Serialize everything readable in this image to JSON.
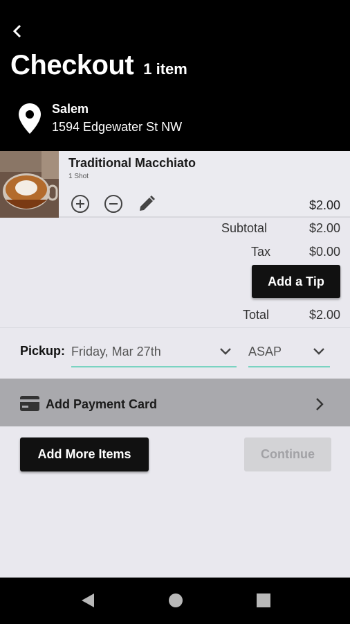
{
  "header": {
    "title": "Checkout",
    "item_count": "1 item",
    "location_name": "Salem",
    "location_address": "1594 Edgewater St NW"
  },
  "item": {
    "name": "Traditional Macchiato",
    "subtitle": "1 Shot",
    "price": "$2.00",
    "icons": [
      "plus-circle-icon",
      "minus-circle-icon",
      "pencil-icon"
    ]
  },
  "totals": {
    "subtotal_label": "Subtotal",
    "subtotal_value": "$2.00",
    "tax_label": "Tax",
    "tax_value": "$0.00",
    "tip_button": "Add a Tip",
    "total_label": "Total",
    "total_value": "$2.00"
  },
  "pickup": {
    "label": "Pickup:",
    "date": "Friday, Mar 27th",
    "time": "ASAP"
  },
  "payment": {
    "label": "Add Payment Card"
  },
  "actions": {
    "add_more": "Add More Items",
    "continue": "Continue"
  },
  "colors": {
    "header_bg": "#000000",
    "accent_underline": "#7ad3c1",
    "payment_bg": "#a9a9ad",
    "page_bg": "#e9e8ee"
  }
}
